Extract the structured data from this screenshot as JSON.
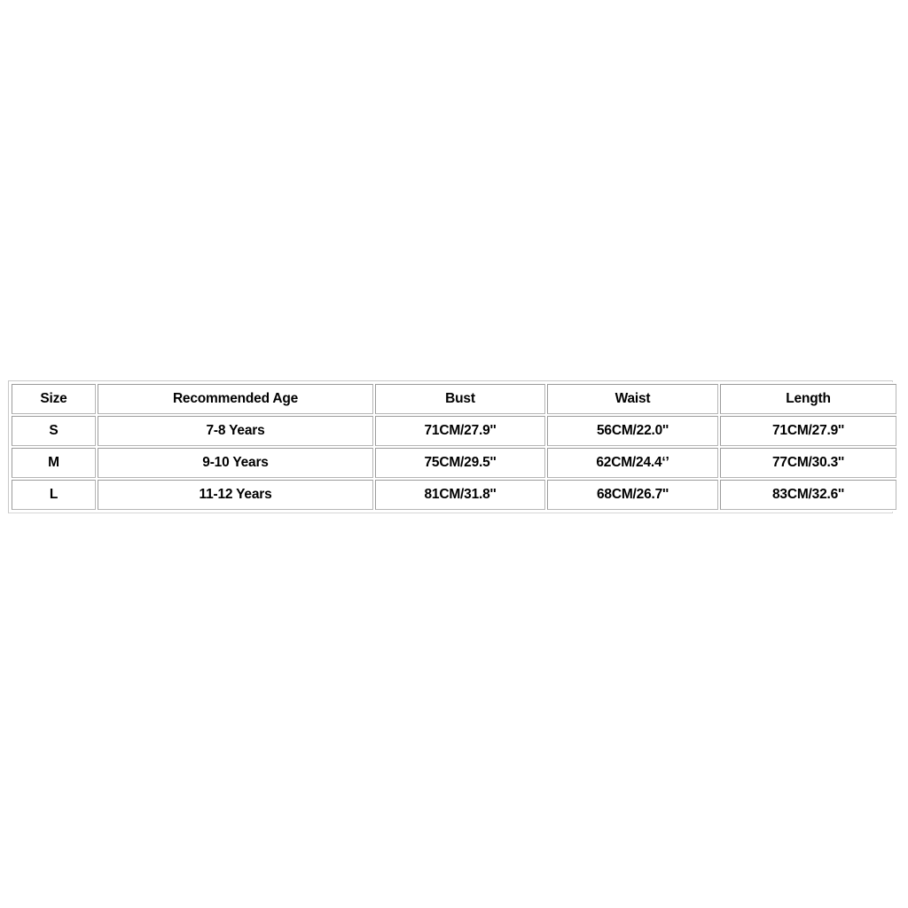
{
  "page": {
    "background_color": "#ffffff",
    "text_color": "#000000",
    "border_color": "#9b9b9b",
    "frame_color": "#c8c8c8"
  },
  "chart_data": {
    "type": "table",
    "title": "",
    "columns": [
      "Size",
      "Recommended Age",
      "Bust",
      "Waist",
      "Length"
    ],
    "rows": [
      {
        "size": "S",
        "age": "7-8 Years",
        "bust": "71CM/27.9''",
        "waist": "56CM/22.0''",
        "length": "71CM/27.9''"
      },
      {
        "size": "M",
        "age": "9-10 Years",
        "bust": "75CM/29.5''",
        "waist": "62CM/24.4‘’",
        "length": "77CM/30.3''"
      },
      {
        "size": "L",
        "age": "11-12 Years",
        "bust": "81CM/31.8''",
        "waist": "68CM/26.7''",
        "length": "83CM/32.6''"
      }
    ]
  }
}
